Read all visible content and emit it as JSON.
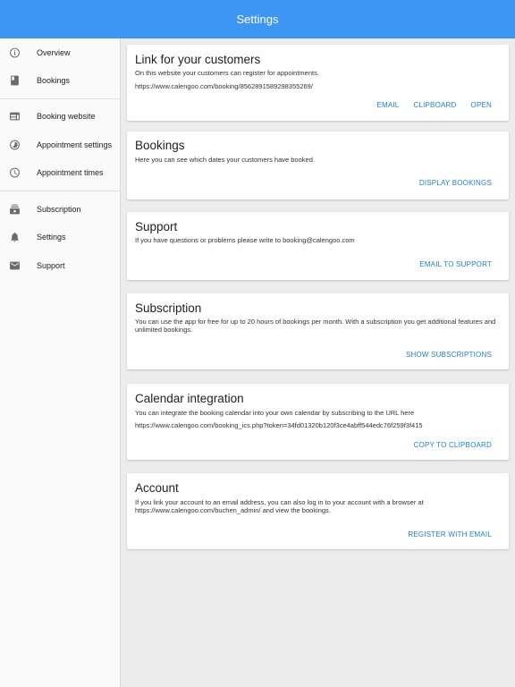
{
  "appbar": {
    "title": "Settings",
    "color": "#3d96f3"
  },
  "sidebar": {
    "items": [
      {
        "label": "Overview",
        "icon": "info-icon"
      },
      {
        "label": "Bookings",
        "icon": "book-icon"
      },
      {
        "label": "Booking website",
        "icon": "web-icon"
      },
      {
        "label": "Appointment settings",
        "icon": "timelapse-icon"
      },
      {
        "label": "Appointment times",
        "icon": "clock-icon"
      },
      {
        "label": "Subscription",
        "icon": "subscriptions-icon"
      },
      {
        "label": "Settings",
        "icon": "bell-icon"
      },
      {
        "label": "Support",
        "icon": "mail-icon"
      }
    ]
  },
  "cards": {
    "link": {
      "title": "Link for your customers",
      "text": "On this website your customers can register for appointments.",
      "url": "https://www.calengoo.com/booking/8562891589298355269/",
      "actions": [
        "EMAIL",
        "CLIPBOARD",
        "OPEN"
      ]
    },
    "bookings": {
      "title": "Bookings",
      "text": "Here you can see which dates your customers have booked.",
      "action": "DISPLAY BOOKINGS"
    },
    "support": {
      "title": "Support",
      "text": "If you have questions or problems please write to booking@calengoo.com",
      "action": "EMAIL TO SUPPORT"
    },
    "subscription": {
      "title": "Subscription",
      "text": "You can use the app for free for up to 20 hours of bookings per month. With a subscription you get additional features and unlimited bookings.",
      "action": "SHOW SUBSCRIPTIONS"
    },
    "calendar": {
      "title": "Calendar integration",
      "text": "You can integrate the booking calendar into your own calendar by subscribing to the URL here",
      "url": "https://www.calengoo.com/booking_ics.php?token=34fd01320b120f3ce4abff544edc76f259f3f415",
      "action": "COPY TO CLIPBOARD"
    },
    "account": {
      "title": "Account",
      "text": "If you link your account to an email address, you can also log in to your account with a browser at https://www.calengoo.com/buchen_admin/ and view the bookings.",
      "action": "REGISTER WITH EMAIL"
    }
  }
}
